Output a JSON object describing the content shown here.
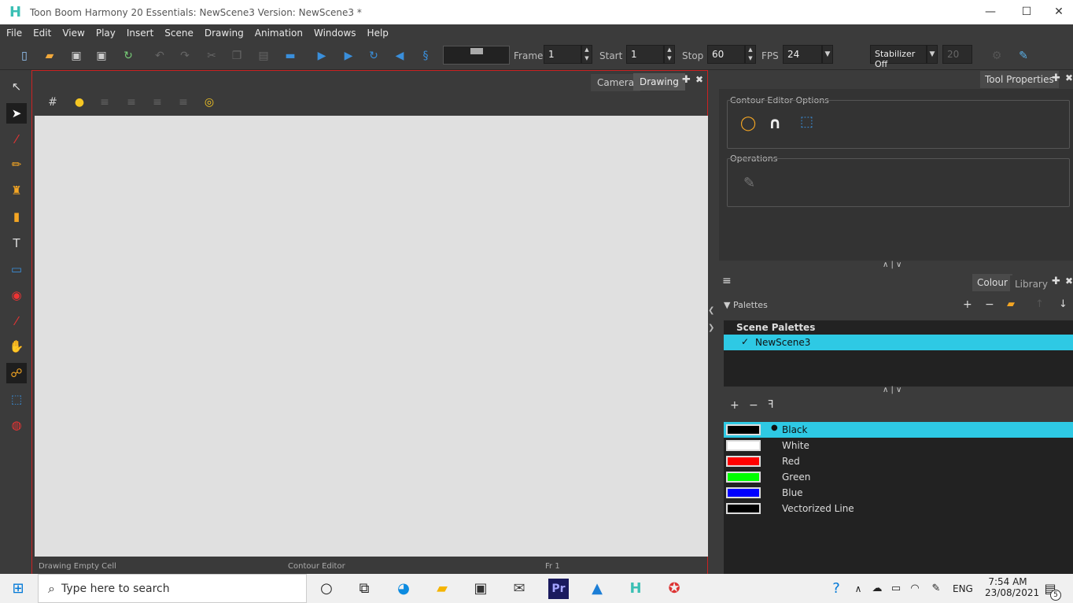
{
  "window": {
    "title": "Toon Boom Harmony 20 Essentials: NewScene3 Version: NewScene3 *",
    "minimize": "—",
    "maximize": "☐",
    "close": "✕"
  },
  "menu": [
    "File",
    "Edit",
    "View",
    "Play",
    "Insert",
    "Scene",
    "Drawing",
    "Animation",
    "Windows",
    "Help"
  ],
  "playback": {
    "frame_label": "Frame",
    "frame_value": "1",
    "start_label": "Start",
    "start_value": "1",
    "stop_label": "Stop",
    "stop_value": "60",
    "fps_label": "FPS",
    "fps_value": "24",
    "stabilizer": "Stabilizer Off",
    "stabilizer_value": "20"
  },
  "drawing_view": {
    "tab_camera": "Camera",
    "tab_drawing": "Drawing",
    "status_left": "Drawing Empty Cell",
    "status_center": "Contour Editor",
    "status_right": "Fr 1"
  },
  "tool_properties": {
    "tab": "Tool Properties",
    "group1": "Contour Editor Options",
    "group2": "Operations"
  },
  "colour_panel": {
    "tab_colour": "Colour",
    "tab_library": "Library",
    "palettes_label": "Palettes",
    "scene_palettes": "Scene Palettes",
    "palette_item": "NewScene3",
    "colors": [
      {
        "name": "Black",
        "hex": "#000000"
      },
      {
        "name": "White",
        "hex": "#ffffff"
      },
      {
        "name": "Red",
        "hex": "#ff0000"
      },
      {
        "name": "Green",
        "hex": "#00ff00"
      },
      {
        "name": "Blue",
        "hex": "#0000ff"
      },
      {
        "name": "Vectorized Line",
        "hex": "#000000"
      }
    ]
  },
  "taskbar": {
    "search_placeholder": "Type here to search",
    "lang": "ENG",
    "time": "7:54 AM",
    "date": "23/08/2021",
    "notif_count": "5"
  }
}
